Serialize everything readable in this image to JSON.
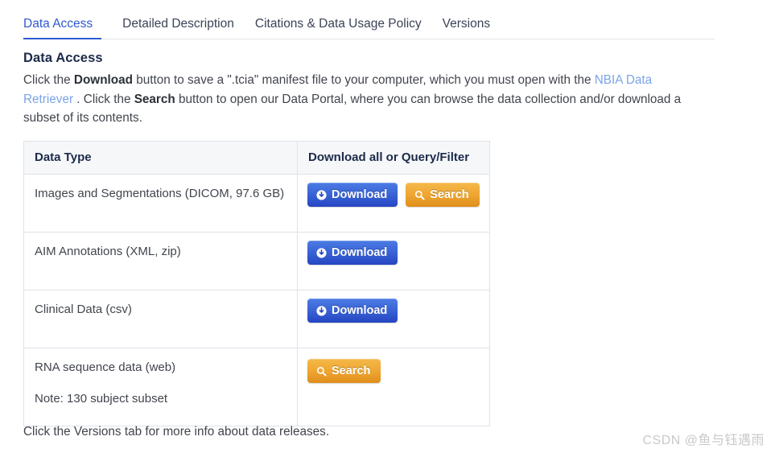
{
  "tabs": [
    {
      "label": "Data Access",
      "active": true
    },
    {
      "label": "Detailed Description",
      "active": false
    },
    {
      "label": "Citations & Data Usage Policy",
      "active": false
    },
    {
      "label": "Versions",
      "active": false
    }
  ],
  "page": {
    "title": "Data Access",
    "intro": {
      "part1": "Click the ",
      "bold1": "Download",
      "part2": " button to save a \".tcia\" manifest file to your computer, which you must open with the ",
      "link1": "NBIA Data Retriever",
      "part3": " . Click the ",
      "bold2": "Search",
      "part4": " button to open our Data Portal, where you can browse the data collection and/or download a subset of its contents."
    },
    "footer_note": "Click the Versions tab for more info about data releases."
  },
  "table": {
    "headers": [
      "Data Type",
      "Download all or Query/Filter"
    ],
    "rows": [
      {
        "type": "Images and Segmentations (DICOM, 97.6 GB)",
        "note": "",
        "buttons": [
          {
            "label": "Download",
            "style": "download",
            "icon": "download-circle-icon"
          },
          {
            "label": "Search",
            "style": "search",
            "icon": "magnifier-icon"
          }
        ]
      },
      {
        "type": "AIM Annotations (XML, zip)",
        "note": "",
        "buttons": [
          {
            "label": "Download",
            "style": "download",
            "icon": "download-circle-icon"
          }
        ]
      },
      {
        "type": "Clinical Data (csv)",
        "note": "",
        "buttons": [
          {
            "label": "Download",
            "style": "download",
            "icon": "download-circle-icon"
          }
        ]
      },
      {
        "type": "RNA sequence data (web)",
        "note": "Note: 130 subject subset",
        "buttons": [
          {
            "label": "Search",
            "style": "search",
            "icon": "magnifier-icon"
          }
        ]
      }
    ]
  },
  "watermark": "CSDN @鱼与钰遇雨",
  "colors": {
    "accent_blue": "#2f5ad0",
    "heading_navy": "#1c2b4a",
    "link_blue": "#7ba3e8",
    "button_blue": "#3a63d6",
    "button_orange": "#efa733",
    "table_border": "#dfe2e8",
    "table_header_bg": "#f6f7f9"
  }
}
